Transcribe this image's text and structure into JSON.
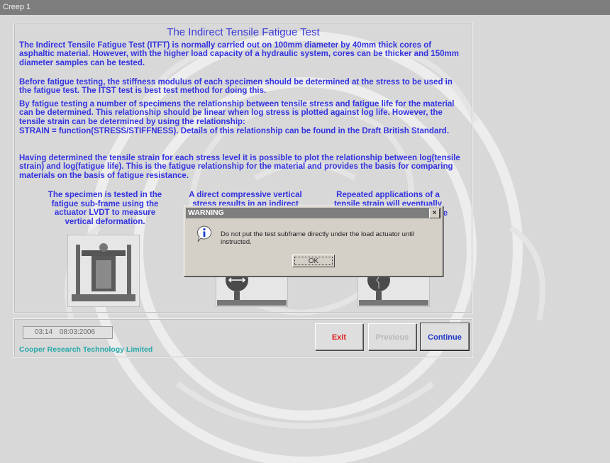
{
  "window": {
    "title": "Creep 1"
  },
  "main": {
    "heading": "The Indirect Tensile Fatigue Test",
    "paragraphs": [
      "The Indirect Tensile Fatigue Test (ITFT) is normally carried out on 100mm diameter by 40mm thick cores of asphaltic material. However, with the higher load capacity of a hydraulic system,  cores can be thicker and 150mm diameter samples can be tested.",
      "Before fatigue testing, the stiffness modulus of each specimen should be determined at the stress to be used in the fatigue test. The ITST test is best test method for doing this.",
      "By fatigue testing a number of specimens the relationship between tensile stress and fatigue life for the material can be determined. This relationship should be linear when log stress is plotted against log life. However, the tensile strain can be determined by using the relationship:",
      "STRAIN = function(STRESS/STIFFNESS). Details of this relationship can be found in the Draft British Standard.",
      "Having determined the tensile strain for each stress level it is possible to plot the relationship between log(tensile strain) and log(fatigue life). This is the fatigue relationship for the material and provides the basis for comparing materials on the basis of fatigue resistance."
    ],
    "captions": [
      "The specimen is tested in the fatigue sub-frame using the actuator LVDT to measure vertical deformation.",
      "A direct compressive vertical stress results in an indirect",
      "Repeated applications of a tensile strain will eventually",
      "e"
    ]
  },
  "status": {
    "time": "03:14",
    "date": "08:03:2006",
    "company": "Cooper Research Technology Limited"
  },
  "buttons": {
    "exit": "Exit",
    "previous": "Previous",
    "continue": "Continue"
  },
  "dialog": {
    "title": "WARNING",
    "close": "×",
    "message": "Do not put the test subframe directly under the load actuator until instructed.",
    "ok": "OK"
  },
  "icons": {
    "info": "info-icon",
    "close": "close-icon",
    "frame": "fatigue-subframe-illustration",
    "specimen": "specimen-illustration"
  },
  "colors": {
    "text": "#3434e0",
    "exit": "#e02020",
    "continue": "#1f38c8",
    "company": "#27a8a8",
    "titlebar": "#7d7d7d"
  }
}
